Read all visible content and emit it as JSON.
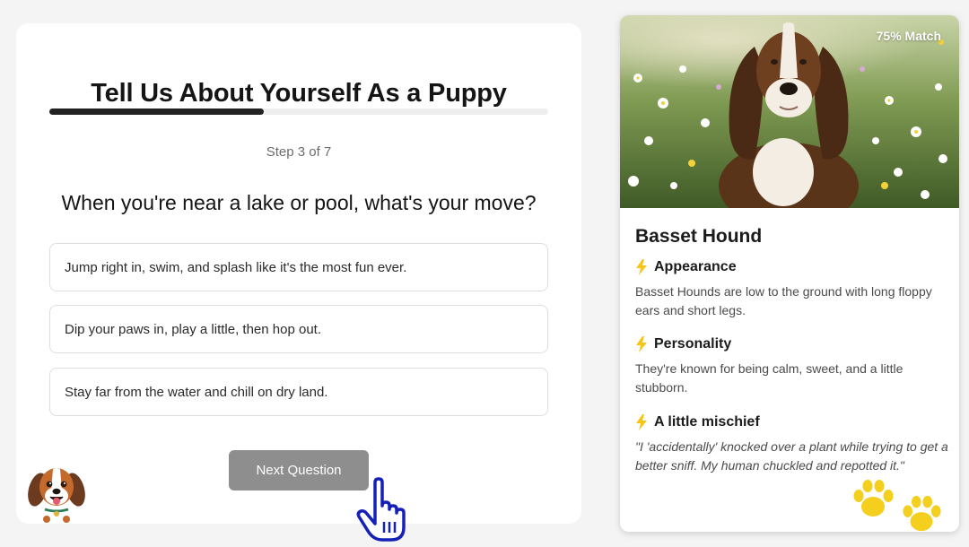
{
  "quiz": {
    "title": "Tell Us About Yourself As a Puppy",
    "progress": 0.43,
    "step_label": "Step 3 of 7",
    "question": "When you're near a lake or pool, what's your move?",
    "options": [
      {
        "label": "Jump right in, swim, and splash like it's the most fun ever."
      },
      {
        "label": "Dip your paws in, play a little, then hop out."
      },
      {
        "label": "Stay far from the water and chill on dry land."
      }
    ],
    "next_label": "Next Question",
    "mascot_icon": "beagle-puppy-icon",
    "cursor_icon": "pointing-hand-cursor-icon"
  },
  "breed": {
    "match_label": "75% Match",
    "name": "Basset Hound",
    "photo_icon": "basset-hound-photo",
    "sections": [
      {
        "icon": "lightning-bolt-icon",
        "heading": "Appearance",
        "text": "Basset Hounds are low to the ground with long floppy ears and short legs."
      },
      {
        "icon": "lightning-bolt-icon",
        "heading": "Personality",
        "text": "They're known for being calm, sweet, and a little stubborn."
      },
      {
        "icon": "lightning-bolt-icon",
        "heading": "A little mischief",
        "text": "\"I 'accidentally' knocked over a plant while trying to get a better sniff. My human chuckled and repotted it.\""
      }
    ],
    "decor_icons": [
      "paw-print-icon",
      "paw-print-icon"
    ]
  },
  "colors": {
    "page_background": "#f4f4f5",
    "progress_fill": "#222222",
    "progress_track": "#eeeeef",
    "button_background": "#8e8e8e",
    "bolt_accent": "#f5c518",
    "paw_accent": "#f5cf1e",
    "cursor_outline": "#1420b8"
  }
}
